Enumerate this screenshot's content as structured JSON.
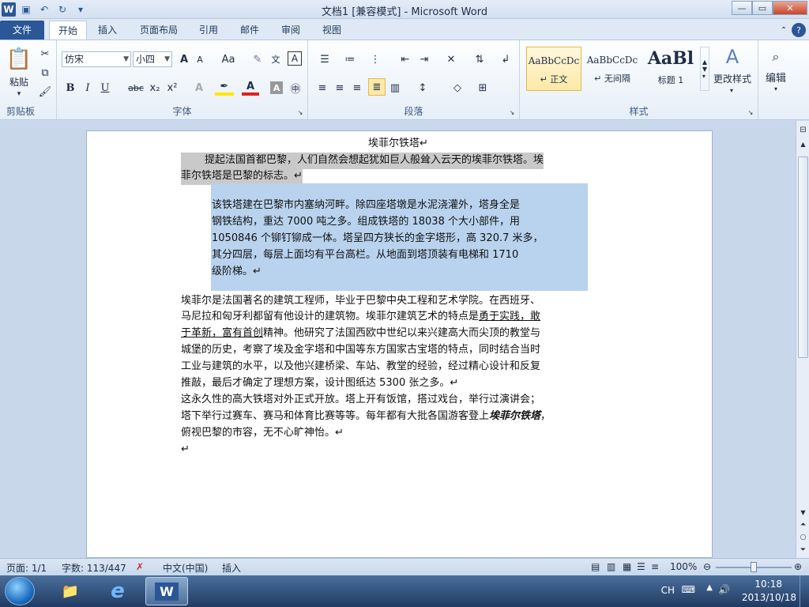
{
  "window": {
    "title": "文档1 [兼容模式] - Microsoft Word",
    "logo": "W",
    "controls": {
      "minimize": "—",
      "maximize": "▭",
      "close": "✕"
    }
  },
  "tabs": [
    {
      "label": "文件"
    },
    {
      "label": "开始"
    },
    {
      "label": "插入"
    },
    {
      "label": "页面布局"
    },
    {
      "label": "引用"
    },
    {
      "label": "邮件"
    },
    {
      "label": "审阅"
    },
    {
      "label": "视图"
    }
  ],
  "ribbon": {
    "clipboard": {
      "paste": "粘贴",
      "label": "剪贴板"
    },
    "font": {
      "name": "仿宋",
      "size": "小四",
      "label": "字体",
      "bold": "B",
      "italic": "I",
      "underline": "U",
      "strike": "abc",
      "subscript": "x₂",
      "superscript": "x²",
      "grow": "A",
      "shrink": "A",
      "case": "Aa",
      "clear": "A"
    },
    "paragraph": {
      "label": "段落"
    },
    "styles": {
      "label": "样式",
      "items": [
        {
          "sample": "AaBbCcDc",
          "name": "↵ 正文"
        },
        {
          "sample": "AaBbCcDc",
          "name": "↵ 无间隔"
        },
        {
          "sample": "AaBl",
          "name": "标题 1"
        }
      ],
      "change": "更改样式"
    },
    "editing": {
      "label": "编辑"
    }
  },
  "document": {
    "title": "埃菲尔铁塔↵",
    "p1": {
      "lines": [
        "提起法国首都巴黎，人们自然会想起犹如巨人般耸入云天的埃菲尔铁塔。埃",
        "菲尔铁塔是巴黎的标志。↵"
      ]
    },
    "p2": {
      "lines": [
        "该铁塔建在巴黎市内塞纳河畔。除四座塔墩是水泥浇灌外，塔身全是",
        "钢铁结构，重达 7000 吨之多。组成铁塔的 18038 个大小部件，用",
        "1050846 个铆钉铆成一体。塔呈四方狭长的金字塔形，高 320.7 米多，",
        "其分四层，每层上面均有平台高栏。从地面到塔顶装有电梯和 1710",
        "级阶梯。↵"
      ]
    },
    "p3": {
      "line1": "埃菲尔是法国著名的建筑工程师，毕业于巴黎中央工程和艺术学院。在西班牙、",
      "line2_pre": "马尼拉和匈牙利都留有他设计的建筑物。埃菲尔建筑艺术的特点是",
      "line2_u": "勇于实践，敢",
      "line3_u": "于革新，富有首创",
      "line3_post": "精神。他研究了法国西欧中世纪以来兴建高大而尖顶的教堂与",
      "line4": "城堡的历史，考察了埃及金字塔和中国等东方国家古宝塔的特点，同时结合当时",
      "line5": "工业与建筑的水平，以及他兴建桥梁、车站、教堂的经验，经过精心设计和反复",
      "line6": "推敲，最后才确定了理想方案，设计图纸达 5300 张之多。↵"
    },
    "p4": {
      "line1": "这永久性的高大铁塔对外正式开放。塔上开有饭馆，搭过戏台，举行过演讲会；",
      "line2_pre": "塔下举行过赛车、赛马和体育比赛等等。每年都有大批各国游客登上",
      "line2_bi": "埃菲尔铁塔",
      "line2_post": "，",
      "line3": "俯视巴黎的市容，无不心旷神怡。↵"
    },
    "end_mark": "↵"
  },
  "statusbar": {
    "page": "页面: 1/1",
    "words": "字数: 113/447",
    "language": "中文(中国)",
    "mode": "插入",
    "zoom": "100%"
  },
  "taskbar": {
    "ime": "CH",
    "time": "10:18",
    "date": "2013/10/18"
  }
}
